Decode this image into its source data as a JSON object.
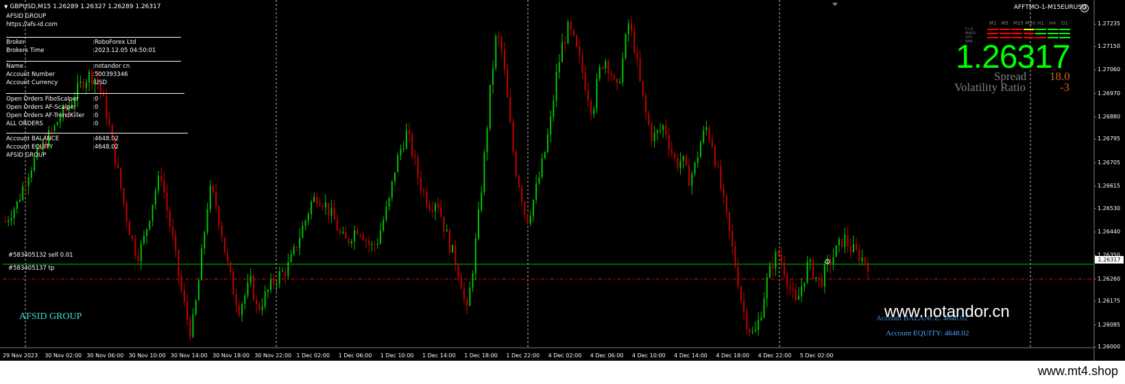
{
  "header": {
    "symbol_line": "GBPUSD,M15  1.26289 1.26327 1.26289 1.26317",
    "brand": "AFSID GROUP",
    "url": "https://afs-id.com"
  },
  "info": {
    "broker_label": "Broker",
    "broker_value": ":RoboForex Ltd",
    "time_label": "Brokers Time",
    "time_value": ":2023.12.05 04:50:01",
    "name_label": "Name",
    "name_value": ":notandor cn",
    "acct_num_label": "Account Number",
    "acct_num_value": ":500393346",
    "currency_label": "Account Currency",
    "currency_value": ":USD",
    "orders": [
      {
        "label": "Open Orders FiboScalper",
        "value": ":0"
      },
      {
        "label": "Open Orders AF-Scalper",
        "value": ":0"
      },
      {
        "label": "Open Orders AF-TrendKiller",
        "value": ":0"
      },
      {
        "label": "ALL ORDERS",
        "value": ":0"
      }
    ],
    "balance_label": "Account BALANCE",
    "balance_value": ":4648.02",
    "equity_label": "Account EQUITY",
    "equity_value": ":4648.02",
    "group_label": "AFSID GROUP"
  },
  "top_right": {
    "symbol": "AFFTMO-1-M15EURUSD",
    "face_icon": "smiley-icon"
  },
  "indicator_panel": {
    "timeframes": [
      "M1",
      "M5",
      "M15",
      "M30",
      "H1",
      "H4",
      "D1"
    ],
    "rows": [
      "C.I.S",
      "MACD",
      "STO",
      "EMA"
    ],
    "colors": {
      "up": "#00ff00",
      "down": "#ff0000",
      "neutral": "#ffff00"
    }
  },
  "price_panel": {
    "big_price": "1.26317",
    "spread_label": "Spread",
    "spread_value": "18.0",
    "vol_label": "Volatility Ratio",
    "vol_value": "-3"
  },
  "orders_on_chart": {
    "sell_label": "#583405132 sell 0.01",
    "tp_label": "#583405137 tp"
  },
  "bottom": {
    "afsid": "AFSID GROUP",
    "watermark": "www.notandor.cn",
    "acc_balance": "Account BALANCE: 4648.02",
    "acc_equity": "Account EQUITY:  4648.02",
    "mt4shop": "www.mt4.shop"
  },
  "price_axis": {
    "labels": [
      "1.27235",
      "1.27150",
      "1.27060",
      "1.26970",
      "1.26880",
      "1.26795",
      "1.26705",
      "1.26615",
      "1.26530",
      "1.26440",
      "1.26350",
      "1.26260",
      "1.26175",
      "1.26085",
      "1.26000"
    ],
    "current": "1.26317"
  },
  "time_axis": {
    "labels": [
      "29 Nov 2023",
      "30 Nov 02:00",
      "30 Nov 06:00",
      "30 Nov 10:00",
      "30 Nov 14:00",
      "30 Nov 18:00",
      "30 Nov 22:00",
      "1 Dec 02:00",
      "1 Dec 06:00",
      "1 Dec 10:00",
      "1 Dec 14:00",
      "1 Dec 18:00",
      "1 Dec 22:00",
      "4 Dec 02:00",
      "4 Dec 06:00",
      "4 Dec 10:00",
      "4 Dec 14:00",
      "4 Dec 18:00",
      "4 Dec 22:00",
      "5 Dec 02:00"
    ]
  },
  "colors": {
    "bull": "#00c800",
    "bear": "#c80000",
    "bg": "#000000",
    "sell_line": "#00c800",
    "tp_line": "#ff0000"
  },
  "chart_data": {
    "type": "candlestick",
    "ylim": [
      1.26,
      1.2727
    ],
    "close_path": [
      1.2648,
      1.2652,
      1.2655,
      1.2662,
      1.2668,
      1.2672,
      1.2676,
      1.268,
      1.2683,
      1.2688,
      1.269,
      1.2694,
      1.2698,
      1.2702,
      1.2704,
      1.2703,
      1.2697,
      1.2688,
      1.2676,
      1.2664,
      1.2652,
      1.2642,
      1.2635,
      1.264,
      1.265,
      1.266,
      1.2666,
      1.2652,
      1.264,
      1.2626,
      1.2614,
      1.2605,
      1.262,
      1.264,
      1.266,
      1.2656,
      1.2645,
      1.2632,
      1.2622,
      1.2615,
      1.262,
      1.2625,
      1.2614,
      1.2618,
      1.2622,
      1.2626,
      1.2628,
      1.263,
      1.2635,
      1.2642,
      1.2648,
      1.2655,
      1.2658,
      1.2656,
      1.2652,
      1.2648,
      1.2642,
      1.264,
      1.2644,
      1.2646,
      1.2642,
      1.2638,
      1.264,
      1.2648,
      1.2655,
      1.2668,
      1.2676,
      1.2682,
      1.2674,
      1.2664,
      1.2658,
      1.2654,
      1.2657,
      1.2648,
      1.264,
      1.2634,
      1.2626,
      1.2612,
      1.263,
      1.265,
      1.2674,
      1.27,
      1.272,
      1.2712,
      1.269,
      1.267,
      1.266,
      1.2648,
      1.2655,
      1.2664,
      1.2674,
      1.2686,
      1.2704,
      1.2716,
      1.2722,
      1.2716,
      1.2708,
      1.2699,
      1.269,
      1.2704,
      1.2711,
      1.2706,
      1.2697,
      1.2709,
      1.2724,
      1.2715,
      1.27,
      1.2688,
      1.268,
      1.2682,
      1.2685,
      1.2676,
      1.267,
      1.2672,
      1.2664,
      1.2668,
      1.2678,
      1.2684,
      1.2678,
      1.2666,
      1.2654,
      1.2642,
      1.263,
      1.2616,
      1.2608,
      1.2604,
      1.2612,
      1.2624,
      1.2632,
      1.2636,
      1.263,
      1.2622,
      1.2616,
      1.2624,
      1.2632,
      1.2628,
      1.2624,
      1.263,
      1.2634,
      1.2638,
      1.2642,
      1.2638,
      1.2636,
      1.2634,
      1.2632
    ]
  }
}
